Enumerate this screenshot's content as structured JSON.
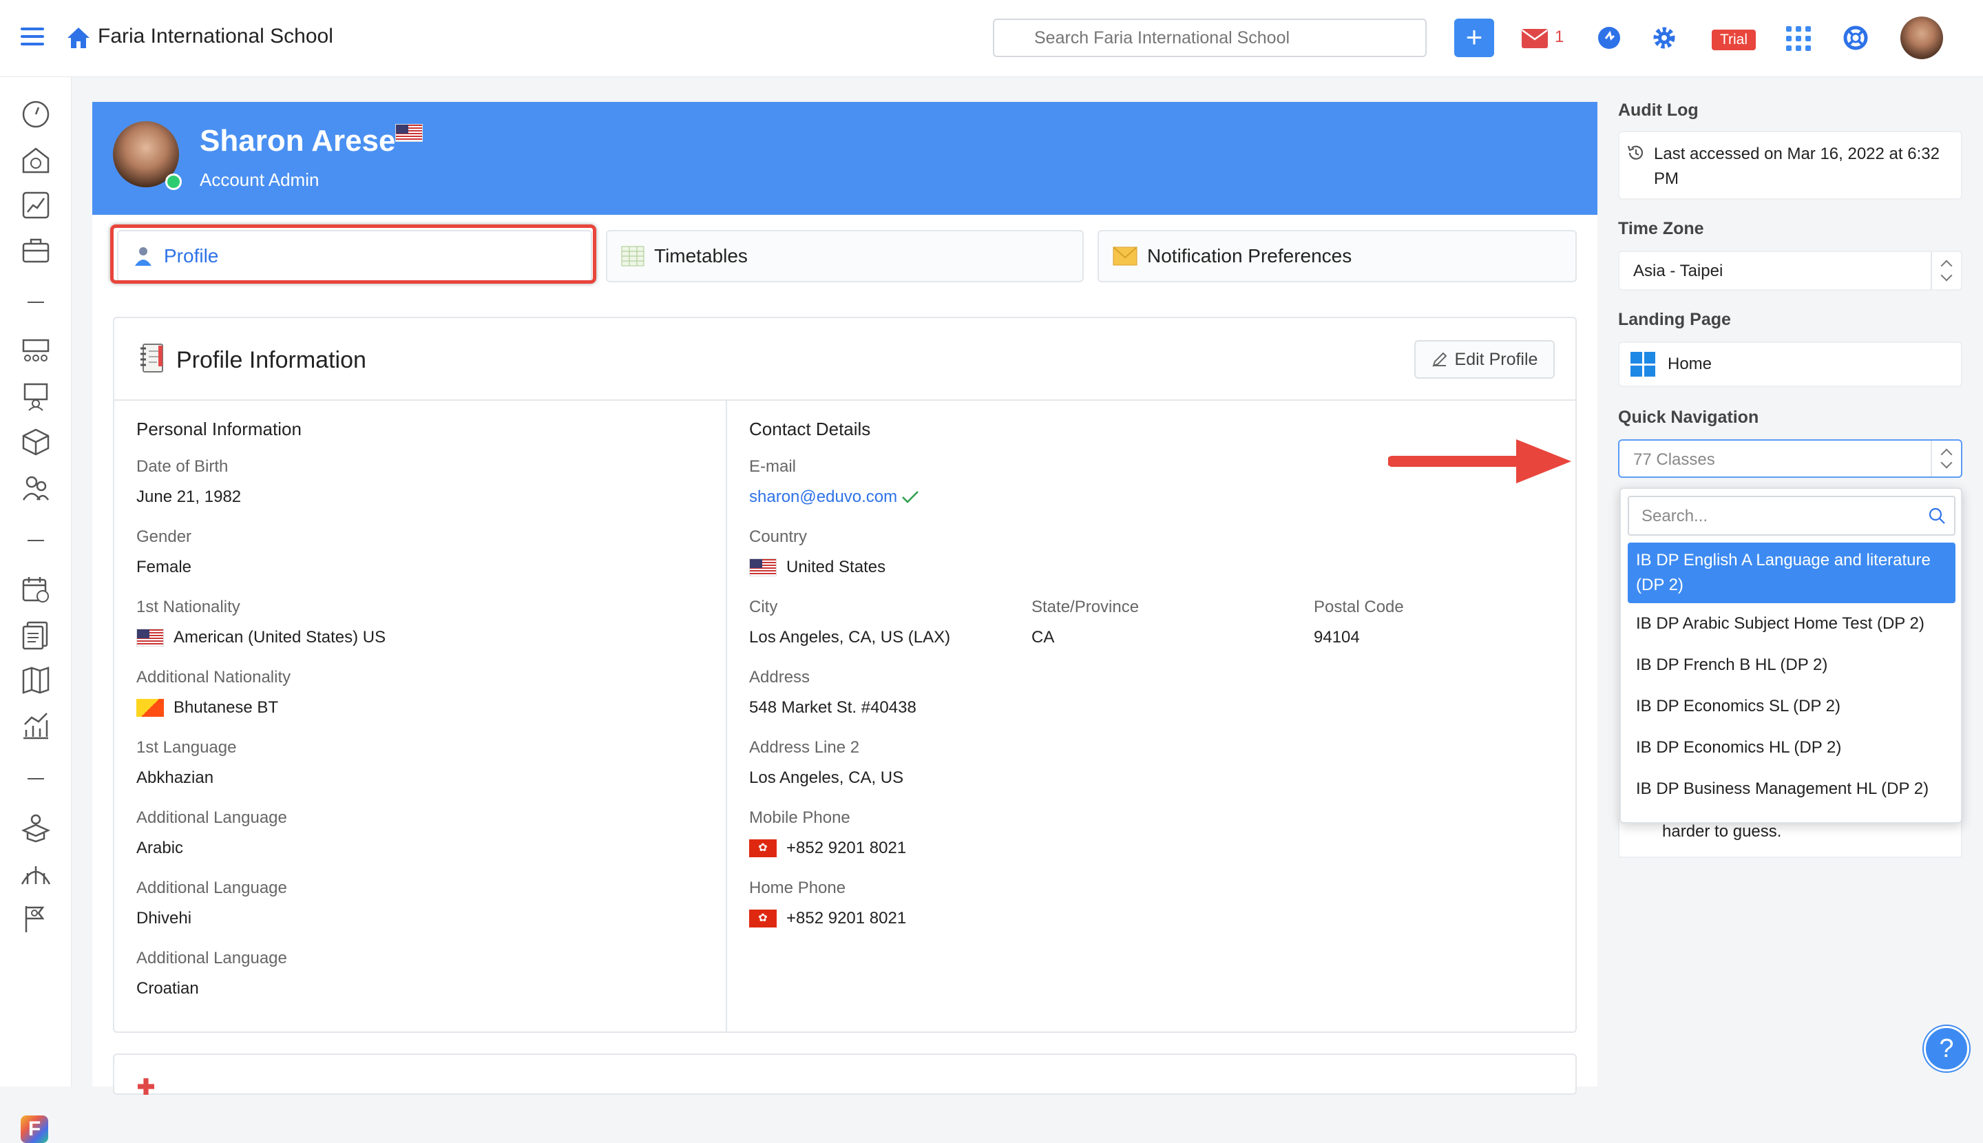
{
  "header": {
    "school_name": "Faria International School",
    "search_placeholder": "Search Faria International School",
    "mail_count": "1",
    "trial_badge": "Trial",
    "add_label": "+"
  },
  "profile": {
    "name": "Sharon Arese",
    "role": "Account Admin"
  },
  "tabs": [
    {
      "label": "Profile",
      "active": true
    },
    {
      "label": "Timetables",
      "active": false
    },
    {
      "label": "Notification Preferences",
      "active": false
    }
  ],
  "card": {
    "title": "Profile Information",
    "edit_label": "Edit Profile"
  },
  "personal": {
    "heading": "Personal Information",
    "dob_label": "Date of Birth",
    "dob": "June 21, 1982",
    "gender_label": "Gender",
    "gender": "Female",
    "nat1_label": "1st Nationality",
    "nat1": "American (United States) US",
    "nat2_label": "Additional Nationality",
    "nat2": "Bhutanese BT",
    "lang1_label": "1st Language",
    "lang1": "Abkhazian",
    "lang2_label": "Additional Language",
    "lang2": "Arabic",
    "lang3_label": "Additional Language",
    "lang3": "Dhivehi",
    "lang4_label": "Additional Language",
    "lang4": "Croatian"
  },
  "contact": {
    "heading": "Contact Details",
    "email_label": "E-mail",
    "email": "sharon@eduvo.com",
    "country_label": "Country",
    "country": "United States",
    "city_label": "City",
    "city": "Los Angeles, CA, US (LAX)",
    "state_label": "State/Province",
    "state": "CA",
    "postal_label": "Postal Code",
    "postal": "94104",
    "address_label": "Address",
    "address": "548 Market St. #40438",
    "address2_label": "Address Line 2",
    "address2": "Los Angeles, CA, US",
    "mobile_label": "Mobile Phone",
    "mobile": "+852 9201 8021",
    "home_label": "Home Phone",
    "home": "+852 9201 8021"
  },
  "right_panel": {
    "audit_label": "Audit Log",
    "audit_text": "Last accessed on Mar 16, 2022 at 6:32 PM",
    "tz_label": "Time Zone",
    "tz_value": "Asia - Taipei",
    "landing_label": "Landing Page",
    "landing_value": "Home",
    "qn_label": "Quick Navigation",
    "qn_value": "77 Classes",
    "dd_search_placeholder": "Search...",
    "options": [
      "IB DP English A Language and literature (DP 2)",
      "IB DP Arabic Subject Home Test (DP 2)",
      "IB DP French B HL (DP 2)",
      "IB DP Economics SL (DP 2)",
      "IB DP Economics HL (DP 2)",
      "IB DP Business Management HL (DP 2)"
    ],
    "behind_text": "harder to guess."
  },
  "colors": {
    "brand_blue": "#4a90f2",
    "accent_red": "#e8453c",
    "link_blue": "#2e72e8"
  },
  "icons": [
    "menu-icon",
    "home-icon",
    "search-icon",
    "plus-icon",
    "mail-icon",
    "chat-icon",
    "gear-icon",
    "apps-grid-icon",
    "lifebuoy-icon",
    "history-icon",
    "windows-icon",
    "pencil-icon",
    "check-icon",
    "help-icon"
  ]
}
